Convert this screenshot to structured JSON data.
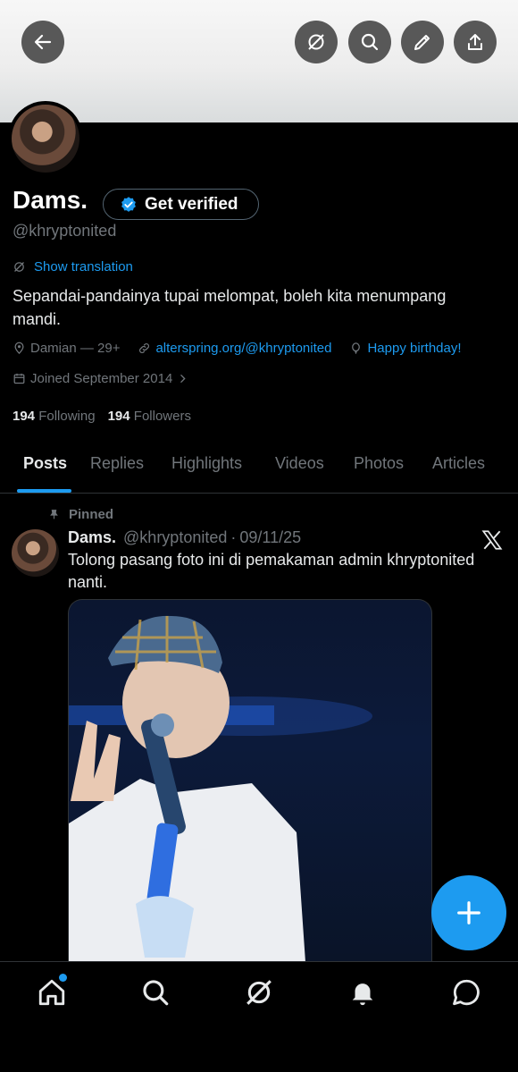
{
  "header": {
    "icons": [
      "back-arrow-icon",
      "grok-icon",
      "search-icon",
      "edit-pencil-icon",
      "share-icon"
    ]
  },
  "profile": {
    "name": "Dams.",
    "handle": "@khryptonited",
    "verify_label": "Get verified",
    "show_translation": "Show translation",
    "bio": "Sepandai-pandainya tupai melompat, boleh kita menumpang mandi.",
    "location": "Damian — 29+",
    "website": "alterspring.org/@khryptonited",
    "birthday": "Happy birthday!",
    "joined": "Joined September 2014",
    "following_count": "194",
    "following_label": "Following",
    "followers_count": "194",
    "followers_label": "Followers"
  },
  "tabs": [
    "Posts",
    "Replies",
    "Highlights",
    "Videos",
    "Photos",
    "Articles"
  ],
  "post": {
    "pinned_label": "Pinned",
    "author": "Dams.",
    "handle": "@khryptonited",
    "separator": "·",
    "date": "09/11/25",
    "text": "Tolong pasang foto ini di pemakaman admin khryptonited nanti."
  },
  "colors": {
    "accent": "#1d9bf0",
    "background": "#000000",
    "muted": "#71767b"
  },
  "nav": {
    "icons": [
      "home-icon",
      "search-icon",
      "grok-icon",
      "notifications-bell-icon",
      "messages-icon"
    ]
  }
}
